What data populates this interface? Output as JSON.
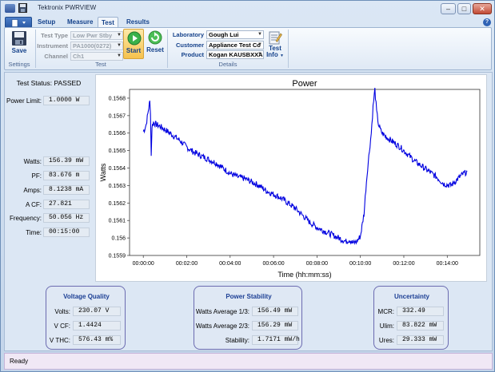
{
  "window": {
    "title": "Tektronix PWRVIEW",
    "minimize": "–",
    "maximize": "□",
    "close": "✕",
    "help": "?"
  },
  "tabs": [
    "Setup",
    "Measure",
    "Test",
    "Results"
  ],
  "ribbon": {
    "settings": {
      "save_label": "Save",
      "group_label": "Settings"
    },
    "test": {
      "group_label": "Test",
      "test_type_label": "Test Type",
      "test_type_value": "Low Pwr Stby",
      "instrument_label": "Instrument",
      "instrument_value": "PA1000(0272)",
      "channel_label": "Channel",
      "channel_value": "Ch1",
      "start_label": "Start",
      "reset_label": "Reset"
    },
    "details": {
      "group_label": "Details",
      "laboratory_label": "Laboratory",
      "laboratory_value": "Gough Lui",
      "customer_label": "Customer",
      "customer_value": "Appliance Test Co",
      "product_label": "Product",
      "product_value": "Kogan KAUSBXXA",
      "test_info_line1": "Test",
      "test_info_line2": "Info"
    }
  },
  "left": {
    "status": "Test Status: PASSED",
    "power_limit_label": "Power Limit:",
    "power_limit_value": "1.0000 W",
    "metrics": [
      {
        "label": "Watts:",
        "value": "156.39 mW"
      },
      {
        "label": "PF:",
        "value": "83.676 m"
      },
      {
        "label": "Amps:",
        "value": "8.1238 mA"
      },
      {
        "label": "A CF:",
        "value": "27.821"
      },
      {
        "label": "Frequency:",
        "value": "50.056 Hz"
      },
      {
        "label": "Time:",
        "value": "00:15:00"
      }
    ]
  },
  "chart_data": {
    "type": "line",
    "title": "Power",
    "xlabel": "Time (hh:mm:ss)",
    "ylabel": "Watts",
    "xlim": [
      -38,
      930
    ],
    "ylim": [
      0.1559,
      0.15685
    ],
    "xticks": [
      "00:00:00",
      "00:02:00",
      "00:04:00",
      "00:06:00",
      "00:08:00",
      "00:10:00",
      "00:12:00",
      "00:14:00"
    ],
    "xtick_seconds": [
      0,
      120,
      240,
      360,
      480,
      600,
      720,
      840
    ],
    "yticks": [
      0.1559,
      0.156,
      0.1561,
      0.1562,
      0.1563,
      0.1564,
      0.1565,
      0.1566,
      0.1567,
      0.1568
    ],
    "ytick_labels": [
      "0.1559",
      "0.156",
      "0.1561",
      "0.1562",
      "0.1563",
      "0.1564",
      "0.1565",
      "0.1566",
      "0.1567",
      "0.1568"
    ],
    "grid": false,
    "color": "#0000e0",
    "series": [
      {
        "x": [
          0,
          3,
          8,
          14,
          18,
          20,
          22,
          24,
          28,
          35,
          45,
          60,
          80,
          100,
          120,
          140,
          160,
          180,
          200,
          220,
          240,
          260,
          280,
          300,
          320,
          340,
          360,
          380,
          400,
          420,
          440,
          460,
          480,
          500,
          520,
          540,
          560,
          570,
          580,
          590,
          600,
          610,
          615,
          620,
          625,
          630,
          635,
          640,
          645,
          650,
          655,
          660,
          670,
          690,
          710,
          730,
          750,
          770,
          790,
          810,
          830,
          850,
          870,
          880,
          895
        ],
        "y": [
          0.15661,
          0.15662,
          0.15665,
          0.15673,
          0.15678,
          0.15672,
          0.15647,
          0.15664,
          0.15666,
          0.15665,
          0.15664,
          0.15662,
          0.15659,
          0.15656,
          0.15652,
          0.15649,
          0.15647,
          0.15645,
          0.15643,
          0.1564,
          0.15637,
          0.15635,
          0.15634,
          0.15632,
          0.1563,
          0.15627,
          0.15625,
          0.15623,
          0.1562,
          0.15617,
          0.15613,
          0.15609,
          0.15606,
          0.15604,
          0.15602,
          0.156,
          0.15598,
          0.15599,
          0.15597,
          0.15598,
          0.15601,
          0.15614,
          0.15628,
          0.1564,
          0.1565,
          0.1566,
          0.15675,
          0.15685,
          0.15672,
          0.15665,
          0.15662,
          0.1566,
          0.15658,
          0.15655,
          0.15652,
          0.15648,
          0.15644,
          0.15641,
          0.15638,
          0.15635,
          0.15631,
          0.1563,
          0.15634,
          0.15636,
          0.15638
        ]
      }
    ]
  },
  "voltage_quality": {
    "title": "Voltage Quality",
    "rows": [
      {
        "label": "Volts:",
        "value": "230.07 V"
      },
      {
        "label": "V CF:",
        "value": "1.4424"
      },
      {
        "label": "V THC:",
        "value": "576.43 m%"
      }
    ]
  },
  "power_stability": {
    "title": "Power Stability",
    "rows": [
      {
        "label": "Watts Average 1/3:",
        "value": "156.49 mW"
      },
      {
        "label": "Watts Average 2/3:",
        "value": "156.29 mW"
      },
      {
        "label": "Stability:",
        "value": "1.7171 mW/h"
      }
    ]
  },
  "uncertainty": {
    "title": "Uncertainty",
    "rows": [
      {
        "label": "MCR:",
        "value": "332.49"
      },
      {
        "label": "Ulim:",
        "value": "83.822 mW"
      },
      {
        "label": "Ures:",
        "value": "29.333 mW"
      }
    ]
  },
  "statusbar": {
    "text": "Ready"
  },
  "colors": {
    "accent": "#15428b",
    "series": "#0000e0",
    "group_border": "#6b6bb0"
  },
  "icons": [
    "app-icon",
    "save-icon",
    "start-icon",
    "reset-icon",
    "test-info-icon",
    "help-icon"
  ]
}
